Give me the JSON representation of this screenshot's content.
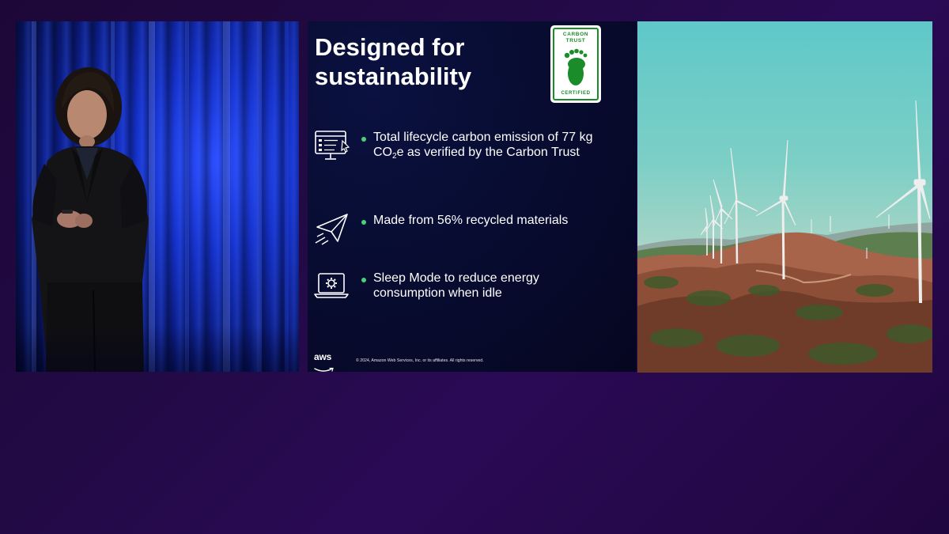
{
  "slide": {
    "title": "Designed for sustainability",
    "badge": {
      "top_text": "CARBON TRUST",
      "bottom_text": "CERTIFIED",
      "icon": "footprint-icon"
    },
    "bullets": [
      {
        "icon": "monitor-cursor-icon",
        "text_before_sub": "Total lifecycle carbon emission of 77 kg CO",
        "sub": "2",
        "text_after_sub": "e as verified by the Carbon Trust"
      },
      {
        "icon": "paper-plane-icon",
        "text": "Made from 56% recycled materials"
      },
      {
        "icon": "laptop-gear-icon",
        "text": "Sleep Mode to reduce energy consumption when idle"
      }
    ],
    "logo_text": "aws",
    "copyright": "© 2024, Amazon Web Services, Inc. or its affiliates. All rights reserved."
  },
  "colors": {
    "background": "#220a45",
    "slide_bg": "#070b2e",
    "bullet_dot": "#49d17a",
    "badge_green": "#1a8c2a",
    "aws_smile": "#ff9900",
    "curtain_blue": "#1430c8"
  }
}
